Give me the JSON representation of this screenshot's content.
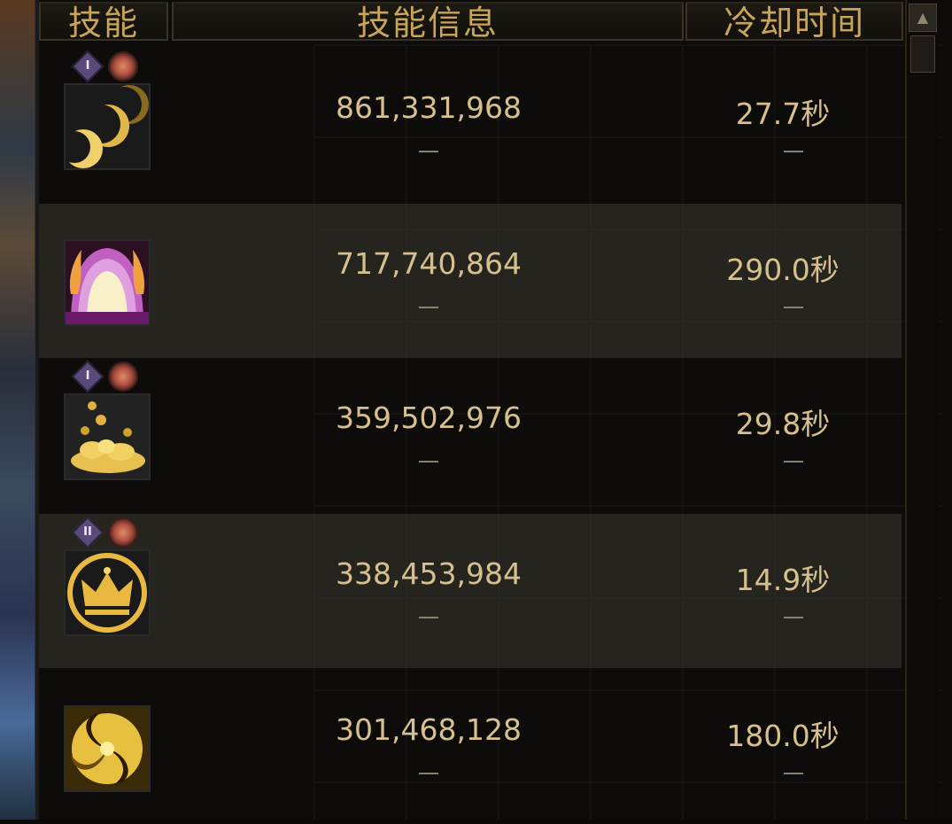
{
  "header": {
    "col_skill": "技能",
    "col_info": "技能信息",
    "col_cooldown": "冷却时间"
  },
  "scrollbar": {
    "up_arrow": "▲"
  },
  "skills": [
    {
      "badge_awake": "I",
      "has_badges": true,
      "damage": "861,331,968",
      "sub_info": "",
      "cooldown": "27.7秒",
      "icon": "triple-moon-icon",
      "highlight": false
    },
    {
      "badge_awake": "",
      "has_badges": false,
      "damage": "717,740,864",
      "sub_info": "",
      "cooldown": "290.0秒",
      "icon": "flame-gate-icon",
      "highlight": true
    },
    {
      "badge_awake": "I",
      "has_badges": true,
      "damage": "359,502,976",
      "sub_info": "",
      "cooldown": "29.8秒",
      "icon": "gold-splash-icon",
      "highlight": false
    },
    {
      "badge_awake": "II",
      "has_badges": true,
      "damage": "338,453,984",
      "sub_info": "",
      "cooldown": "14.9秒",
      "icon": "crown-emblem-icon",
      "highlight": true
    },
    {
      "badge_awake": "",
      "has_badges": false,
      "damage": "301,468,128",
      "sub_info": "",
      "cooldown": "180.0秒",
      "icon": "golden-vortex-icon",
      "highlight": false
    }
  ],
  "colors": {
    "text_gold": "#d6c08e",
    "header_gold": "#c9a55a",
    "row_highlight": "#3c3830"
  }
}
